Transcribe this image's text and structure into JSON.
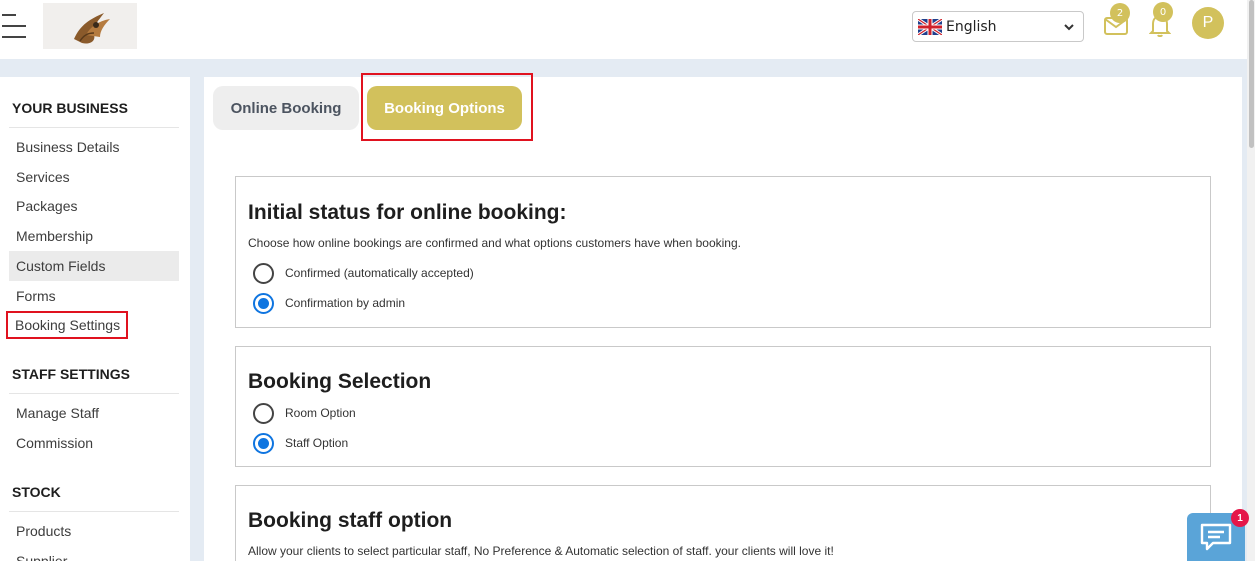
{
  "header": {
    "language": {
      "selected": "English",
      "flag": "uk-flag-icon"
    },
    "mail_badge": "2",
    "notification_badge": "0",
    "avatar_initial": "P",
    "accent_color": "#d2c15c"
  },
  "sidebar": {
    "sections": [
      {
        "title": "YOUR BUSINESS",
        "items": [
          "Business Details",
          "Services",
          "Packages",
          "Membership",
          "Custom Fields",
          "Forms",
          "Booking Settings"
        ]
      },
      {
        "title": "STAFF SETTINGS",
        "items": [
          "Manage Staff",
          "Commission"
        ]
      },
      {
        "title": "STOCK",
        "items": [
          "Products",
          "Supplier"
        ]
      }
    ],
    "active_item": "Custom Fields",
    "highlighted_item": "Booking Settings"
  },
  "tabs": [
    {
      "label": "Online Booking",
      "active": false
    },
    {
      "label": "Booking Options",
      "active": true
    }
  ],
  "cards": [
    {
      "title": "Initial status for online booking:",
      "description": "Choose how online bookings are confirmed and what options customers have when booking.",
      "options": [
        {
          "label": "Confirmed (automatically accepted)",
          "checked": false
        },
        {
          "label": "Confirmation by admin",
          "checked": true
        }
      ]
    },
    {
      "title": "Booking Selection",
      "options": [
        {
          "label": "Room Option",
          "checked": false
        },
        {
          "label": "Staff Option",
          "checked": true
        }
      ]
    },
    {
      "title": "Booking staff option",
      "description": "Allow your clients to select particular staff, No Preference & Automatic selection of staff. your clients will love it!"
    }
  ],
  "chat": {
    "badge": "1"
  }
}
